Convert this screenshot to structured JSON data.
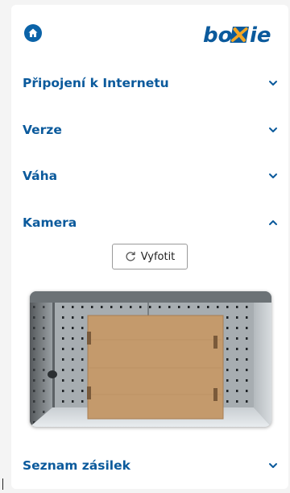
{
  "header": {
    "home_icon": "home-icon",
    "logo_text": "boxie",
    "brand_color": "#0b5a9c",
    "logo_accent": "#f5a623"
  },
  "sections": [
    {
      "label": "Připojení k Internetu",
      "expanded": false
    },
    {
      "label": "Verze",
      "expanded": false
    },
    {
      "label": "Váha",
      "expanded": false
    },
    {
      "label": "Kamera",
      "expanded": true
    },
    {
      "label": "Seznam zásilek",
      "expanded": false
    }
  ],
  "camera": {
    "photo_button_label": "Vyfotit",
    "photo_button_icon": "refresh-icon",
    "image_description_icon": "camera-preview"
  }
}
